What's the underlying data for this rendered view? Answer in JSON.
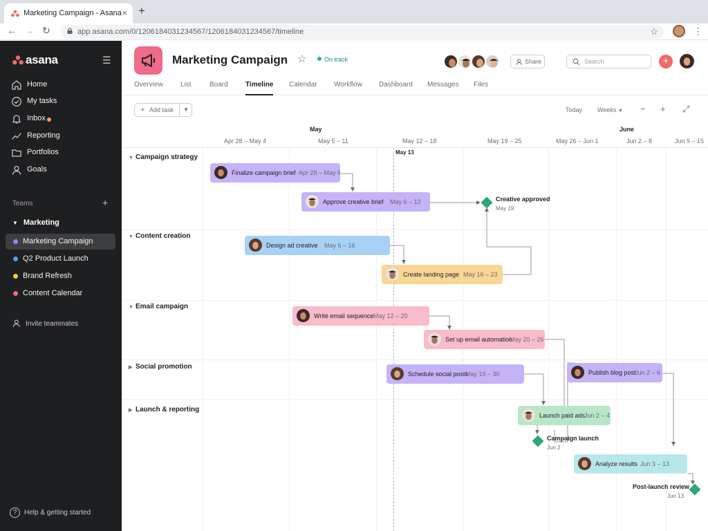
{
  "browser": {
    "tab_title": "Marketing Campaign - Asana",
    "close_glyph": "×",
    "new_tab_glyph": "+",
    "url": "app.asana.com/0/1206184031234567/1206184031234567/timeline",
    "back_glyph": "←",
    "forward_glyph": "→",
    "reload_glyph": "↻",
    "star_glyph": "☆",
    "menu_glyph": "⋮"
  },
  "sidebar": {
    "logo": "asana",
    "nav": [
      {
        "label": "Home",
        "icon": "home-icon"
      },
      {
        "label": "My tasks",
        "icon": "check-circle-icon"
      },
      {
        "label": "Inbox",
        "icon": "bell-icon"
      },
      {
        "label": "Reporting",
        "icon": "trend-icon"
      },
      {
        "label": "Portfolios",
        "icon": "folder-icon"
      },
      {
        "label": "Goals",
        "icon": "person-icon"
      }
    ],
    "teams_label": "Teams",
    "team_name": "Marketing",
    "projects": [
      {
        "label": "Marketing Campaign",
        "color": "#9b7ff5"
      },
      {
        "label": "Q2 Product Launch",
        "color": "#4c9ff0"
      },
      {
        "label": "Brand Refresh",
        "color": "#f4cd3f"
      },
      {
        "label": "Content Calendar",
        "color": "#f06a8a"
      }
    ],
    "invite": "Invite teammates",
    "help": "Help & getting started",
    "help_glyph": "?"
  },
  "header": {
    "title": "Marketing Campaign",
    "status": "On track",
    "share": "Share",
    "search_placeholder": "Search",
    "add_glyph": "+",
    "title_caret": "⌄",
    "title_star": "☆"
  },
  "tabs": [
    "Overview",
    "List",
    "Board",
    "Timeline",
    "Calendar",
    "Workflow",
    "Dashboard",
    "Messages",
    "Files"
  ],
  "toolbar": {
    "add_task": "Add task",
    "today": "Today",
    "zoom": "Weeks",
    "zoom_out": "−",
    "zoom_in": "+",
    "expand": "⤢"
  },
  "timeline": {
    "months": [
      "May",
      "June"
    ],
    "weeks": [
      "Apr 28 – May 4",
      "May 5 – 11",
      "May 12 – 18",
      "May 19 – 25",
      "May 26 – Jun 1",
      "Jun 2 – 8",
      "Jun 9 – 15"
    ],
    "today_label": "May 13",
    "sections": [
      "Campaign strategy",
      "Content creation",
      "Email campaign",
      "Social promotion",
      "Launch & reporting"
    ],
    "tasks": [
      {
        "name": "Finalize campaign brief",
        "dates": "Apr 28 – May 6",
        "color": "#c5b3f7"
      },
      {
        "name": "Approve creative brief",
        "dates": "May 6 – 12",
        "color": "#c5b3f7"
      },
      {
        "name": "Design ad creative",
        "dates": "May 6 – 16",
        "color": "#a8d2f5"
      },
      {
        "name": "Create landing page",
        "dates": "May 16 – 23",
        "color": "#f8d693"
      },
      {
        "name": "Write email sequence",
        "dates": "May 12 – 20",
        "color": "#f8bccb"
      },
      {
        "name": "Set up email automation",
        "dates": "May 20 – 26",
        "color": "#f8bccb"
      },
      {
        "name": "Schedule social posts",
        "dates": "May 19 – 30",
        "color": "#c5b3f7"
      },
      {
        "name": "Publish blog post",
        "dates": "Jun 2 – 6",
        "color": "#c5b3f7"
      },
      {
        "name": "Launch paid ads",
        "dates": "Jun 2 – 4",
        "color": "#b8e6c7"
      },
      {
        "name": "Analyze results",
        "dates": "Jun 3 – 13",
        "color": "#b7e7ec"
      }
    ],
    "milestones": [
      {
        "name": "Creative approved",
        "date": "May 19"
      },
      {
        "name": "Campaign launch",
        "date": "Jun 2"
      },
      {
        "name": "Post-launch review",
        "date": "Jun 13"
      }
    ]
  }
}
